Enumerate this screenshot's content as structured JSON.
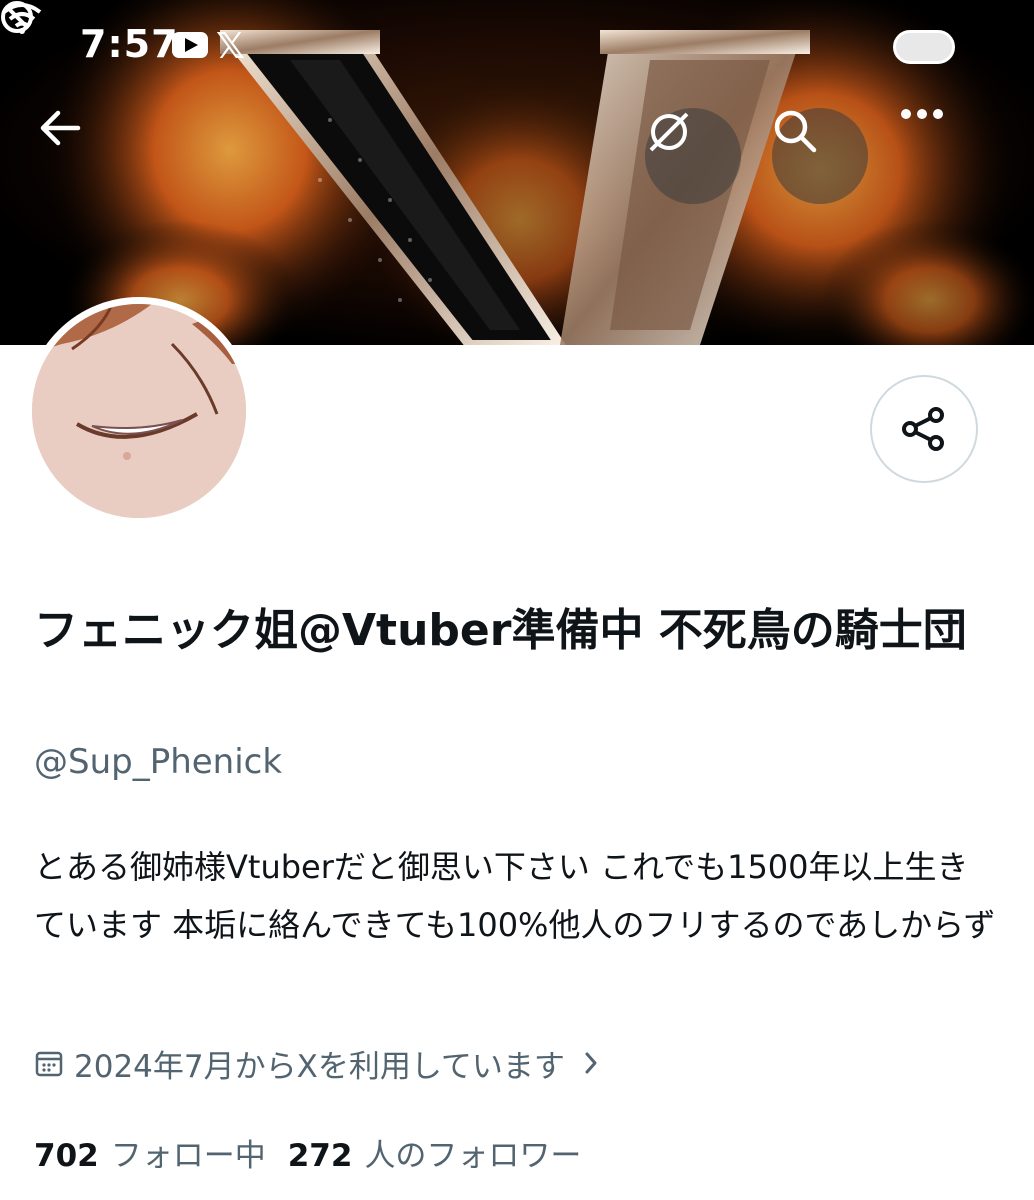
{
  "status_bar": {
    "time": "7:57",
    "icons": [
      "youtube-icon",
      "x-logo-icon",
      "wifi-icon",
      "do-not-disturb-icon",
      "battery-icon"
    ],
    "x_glyph": "𝕏"
  },
  "nav": {
    "back": "back-arrow-icon",
    "grok": "grok-icon",
    "search": "search-icon",
    "more": "more-icon"
  },
  "profile": {
    "display_name": "フェニック姐@Vtuber準備中 不死鳥の騎士団",
    "handle": "@Sup_Phenick",
    "bio": "とある御姉様Vtuberだと御思い下さい これでも1500年以上生きています 本垢に絡んできても100%他人のフリするのであしからず",
    "joined": "2024年7月からXを利用しています",
    "following_count": "702",
    "following_label": "フォロー中",
    "followers_count": "272",
    "followers_label": "人のフォロワー"
  },
  "colors": {
    "text_primary": "#0f1419",
    "text_secondary": "#536471",
    "border": "#cfd9de",
    "banner_fire": "#e0631c"
  }
}
